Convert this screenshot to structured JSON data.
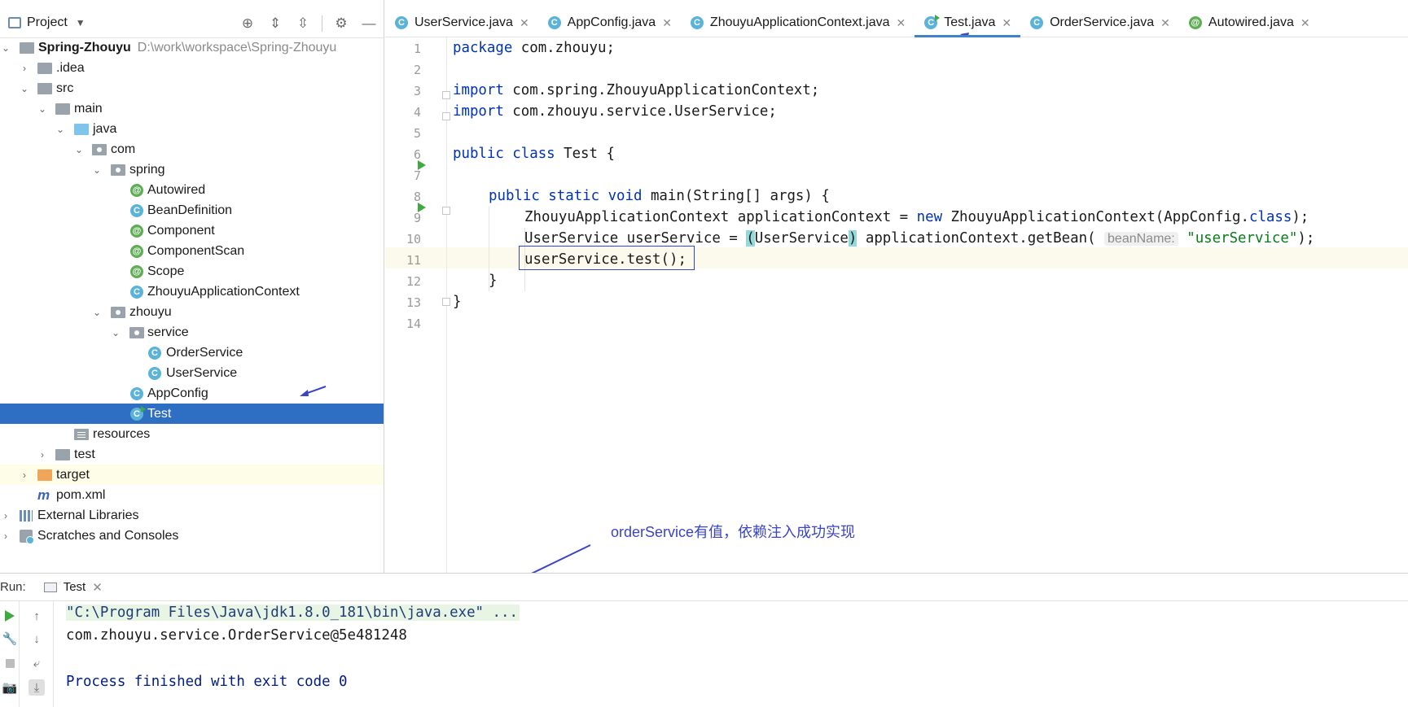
{
  "project_panel": {
    "title": "Project",
    "tools": [
      "locate-icon",
      "expand-all-icon",
      "collapse-all-icon",
      "gear-icon",
      "minimize-icon"
    ],
    "tree": [
      {
        "label": "Spring-Zhouyu",
        "path": "D:\\work\\workspace\\Spring-Zhouyu",
        "icon": "module-folder-icon"
      },
      {
        "label": ".idea",
        "icon": "folder-icon"
      },
      {
        "label": "src",
        "icon": "folder-icon"
      },
      {
        "label": "main",
        "icon": "folder-icon"
      },
      {
        "label": "java",
        "icon": "source-folder-icon"
      },
      {
        "label": "com",
        "icon": "package-icon"
      },
      {
        "label": "spring",
        "icon": "package-icon"
      },
      {
        "label": "Autowired",
        "icon": "annotation-icon"
      },
      {
        "label": "BeanDefinition",
        "icon": "class-icon"
      },
      {
        "label": "Component",
        "icon": "annotation-icon"
      },
      {
        "label": "ComponentScan",
        "icon": "annotation-icon"
      },
      {
        "label": "Scope",
        "icon": "annotation-icon"
      },
      {
        "label": "ZhouyuApplicationContext",
        "icon": "class-icon"
      },
      {
        "label": "zhouyu",
        "icon": "package-icon"
      },
      {
        "label": "service",
        "icon": "package-icon"
      },
      {
        "label": "OrderService",
        "icon": "class-icon"
      },
      {
        "label": "UserService",
        "icon": "class-icon"
      },
      {
        "label": "AppConfig",
        "icon": "class-icon"
      },
      {
        "label": "Test",
        "icon": "runnable-class-icon",
        "selected": true
      },
      {
        "label": "resources",
        "icon": "resources-folder-icon"
      },
      {
        "label": "test",
        "icon": "folder-icon"
      },
      {
        "label": "target",
        "icon": "excluded-folder-icon"
      },
      {
        "label": "pom.xml",
        "icon": "maven-icon"
      },
      {
        "label": "External Libraries",
        "icon": "libraries-icon"
      },
      {
        "label": "Scratches and Consoles",
        "icon": "scratches-icon"
      }
    ]
  },
  "editor_tabs": [
    {
      "label": "UserService.java",
      "icon": "class-icon"
    },
    {
      "label": "AppConfig.java",
      "icon": "class-icon"
    },
    {
      "label": "ZhouyuApplicationContext.java",
      "icon": "class-icon"
    },
    {
      "label": "Test.java",
      "icon": "runnable-class-icon",
      "active": true
    },
    {
      "label": "OrderService.java",
      "icon": "class-icon"
    },
    {
      "label": "Autowired.java",
      "icon": "annotation-icon"
    }
  ],
  "editor": {
    "line_numbers": [
      "1",
      "2",
      "3",
      "4",
      "5",
      "6",
      "7",
      "8",
      "9",
      "10",
      "11",
      "12",
      "13",
      "14"
    ],
    "current_line": 10,
    "code": {
      "l1_kw": "package",
      "l1_rest": " com.zhouyu;",
      "l3_kw": "import",
      "l3_rest": " com.spring.ZhouyuApplicationContext;",
      "l4_kw": "import",
      "l4_rest": " com.zhouyu.service.UserService;",
      "l6_kw": "public class",
      "l6_rest": " Test {",
      "l8_kw": "public static void",
      "l8_rest": " main(String[] args) {",
      "l9_a": "ZhouyuApplicationContext applicationContext = ",
      "l9_kw": "new",
      "l9_b": " ZhouyuApplicationContext(AppConfig.",
      "l9_kw2": "class",
      "l9_c": ");",
      "l10_a": "UserService userService = ",
      "l10_p1": "(",
      "l10_b": "UserService",
      "l10_p2": ")",
      "l10_c": " applicationContext.getBean(",
      "l10_hint": "beanName:",
      "l10_str": "\"userService\"",
      "l10_d": ");",
      "l11": "userService.test();",
      "l12": "}",
      "l13": "}"
    }
  },
  "annotation": {
    "note": "orderService有值，依赖注入成功实现",
    "color": "#3a44c9"
  },
  "run_panel": {
    "label": "Run:",
    "tab": "Test",
    "tools": [
      "rerun-icon",
      "wrench-icon",
      "stop-icon",
      "camera-icon",
      "up-arrow-icon",
      "down-arrow-icon",
      "soft-wrap-icon",
      "scroll-to-end-icon"
    ],
    "output": [
      "\"C:\\Program Files\\Java\\jdk1.8.0_181\\bin\\java.exe\" ...",
      "com.zhouyu.service.OrderService@5e481248",
      "",
      "Process finished with exit code 0"
    ]
  },
  "colors": {
    "selection": "#2f6fc3",
    "keyword": "#0033b3",
    "string": "#067d17",
    "run_green": "#3faa3f"
  }
}
